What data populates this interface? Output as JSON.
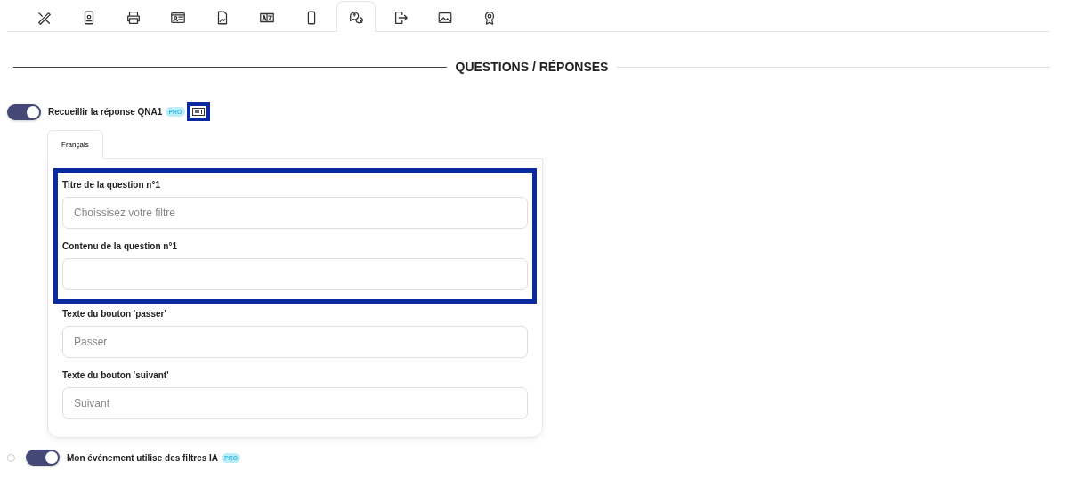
{
  "toolbar_tabs": [
    {
      "kind": "pencil-ruler",
      "selected": false
    },
    {
      "kind": "badge",
      "selected": false
    },
    {
      "kind": "printer",
      "selected": false
    },
    {
      "kind": "id-card",
      "selected": false
    },
    {
      "kind": "document",
      "selected": false
    },
    {
      "kind": "translate",
      "selected": false
    },
    {
      "kind": "phone",
      "selected": false
    },
    {
      "kind": "chat",
      "selected": true
    },
    {
      "kind": "export",
      "selected": false
    },
    {
      "kind": "image",
      "selected": false
    },
    {
      "kind": "award",
      "selected": false
    }
  ],
  "section_title": "QUESTIONS / RÉPONSES",
  "qna_toggle": {
    "label": "Recueillir la réponse QNA1",
    "on": true,
    "badge": "PRO",
    "format_icon_highlighted": true
  },
  "language_tabs": [
    {
      "label": "Français",
      "selected": true
    }
  ],
  "fields": [
    {
      "label": "Titre de la question n°1",
      "placeholder": "Choissisez votre filtre",
      "highlighted": true
    },
    {
      "label": "Contenu de la question n°1",
      "highlighted": true
    },
    {
      "label": "Texte du bouton 'passer'",
      "placeholder": "Passer",
      "highlighted": false
    },
    {
      "label": "Texte du bouton 'suivant'",
      "placeholder": "Suivant",
      "highlighted": false
    }
  ],
  "ai_toggle": {
    "label": "Mon événement utilise des filtres IA",
    "on": true,
    "badge": "PRO"
  }
}
